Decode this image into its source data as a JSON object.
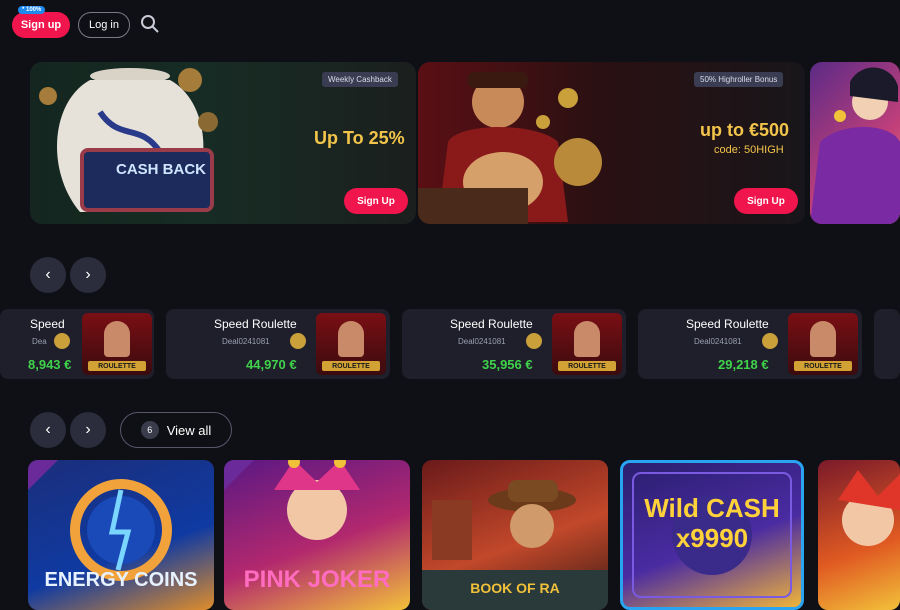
{
  "header": {
    "signup_label": "Sign up",
    "signup_tag": "* 100%",
    "login_label": "Log in",
    "search_icon": "search-icon"
  },
  "banners": [
    {
      "tag": "Weekly Cashback",
      "headline": "Up To 25%",
      "cta": "Sign Up",
      "art_text": "CASH BACK"
    },
    {
      "tag": "50% Highroller Bonus",
      "headline": "up to €500",
      "code": "code: 50HIGH",
      "cta": "Sign Up"
    }
  ],
  "live": {
    "cards": [
      {
        "title": "Speed",
        "sub": "Dea",
        "amount": "8,943 €"
      },
      {
        "title": "Speed Roulette",
        "sub": "Deal0241081",
        "amount": "44,970 €"
      },
      {
        "title": "Speed Roulette",
        "sub": "Deal0241081",
        "amount": "35,956 €"
      },
      {
        "title": "Speed Roulette",
        "sub": "Deal0241081",
        "amount": "29,218 €"
      }
    ],
    "thumb_label": "ROULETTE"
  },
  "games_section": {
    "view_all_label": "View all",
    "view_all_count": "6"
  },
  "games": [
    {
      "title": "ENERGY COINS"
    },
    {
      "title": "PINK JOKER"
    },
    {
      "title": "BOOK OF RA"
    },
    {
      "title": "Wild CASH x9990"
    },
    {
      "title": ""
    }
  ],
  "colors": {
    "accent": "#f0154c",
    "amount_green": "#40d24a",
    "promo_gold": "#f3c44a",
    "highlight_border": "#29a4f0"
  }
}
